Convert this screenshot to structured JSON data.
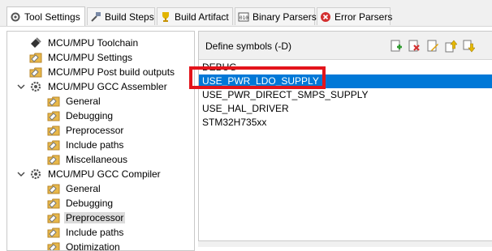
{
  "tabs": [
    {
      "label": "Tool Settings",
      "icon": "tool-settings-icon",
      "active": true
    },
    {
      "label": "Build Steps",
      "icon": "build-steps-icon",
      "active": false
    },
    {
      "label": "Build Artifact",
      "icon": "trophy-icon",
      "active": false
    },
    {
      "label": "Binary Parsers",
      "icon": "binary-icon",
      "active": false
    },
    {
      "label": "Error Parsers",
      "icon": "error-icon",
      "active": false
    }
  ],
  "tree": [
    {
      "label": "MCU/MPU Toolchain",
      "level": 0,
      "expandable": false,
      "selected": false
    },
    {
      "label": "MCU/MPU Settings",
      "level": 0,
      "expandable": false,
      "selected": false
    },
    {
      "label": "MCU/MPU Post build outputs",
      "level": 0,
      "expandable": false,
      "selected": false
    },
    {
      "label": "MCU/MPU GCC Assembler",
      "level": 0,
      "expandable": true,
      "selected": false
    },
    {
      "label": "General",
      "level": 1,
      "expandable": false,
      "selected": false
    },
    {
      "label": "Debugging",
      "level": 1,
      "expandable": false,
      "selected": false
    },
    {
      "label": "Preprocessor",
      "level": 1,
      "expandable": false,
      "selected": false
    },
    {
      "label": "Include paths",
      "level": 1,
      "expandable": false,
      "selected": false
    },
    {
      "label": "Miscellaneous",
      "level": 1,
      "expandable": false,
      "selected": false
    },
    {
      "label": "MCU/MPU GCC Compiler",
      "level": 0,
      "expandable": true,
      "selected": false
    },
    {
      "label": "General",
      "level": 1,
      "expandable": false,
      "selected": false
    },
    {
      "label": "Debugging",
      "level": 1,
      "expandable": false,
      "selected": false
    },
    {
      "label": "Preprocessor",
      "level": 1,
      "expandable": false,
      "selected": true
    },
    {
      "label": "Include paths",
      "level": 1,
      "expandable": false,
      "selected": false
    },
    {
      "label": "Optimization",
      "level": 1,
      "expandable": false,
      "selected": false
    }
  ],
  "symbols_panel": {
    "title": "Define symbols (-D)",
    "toolbar": [
      "add-icon",
      "delete-icon",
      "edit-icon",
      "move-up-icon",
      "move-down-icon"
    ],
    "items": [
      {
        "label": "DEBUG",
        "selected": false
      },
      {
        "label": "USE_PWR_LDO_SUPPLY",
        "selected": true
      },
      {
        "label": "USE_PWR_DIRECT_SMPS_SUPPLY",
        "selected": false
      },
      {
        "label": "USE_HAL_DRIVER",
        "selected": false
      },
      {
        "label": "STM32H735xx",
        "selected": false
      }
    ]
  },
  "colors": {
    "selection": "#0078d7",
    "highlight_box": "#e3141b",
    "folder": "#e8b84a"
  }
}
